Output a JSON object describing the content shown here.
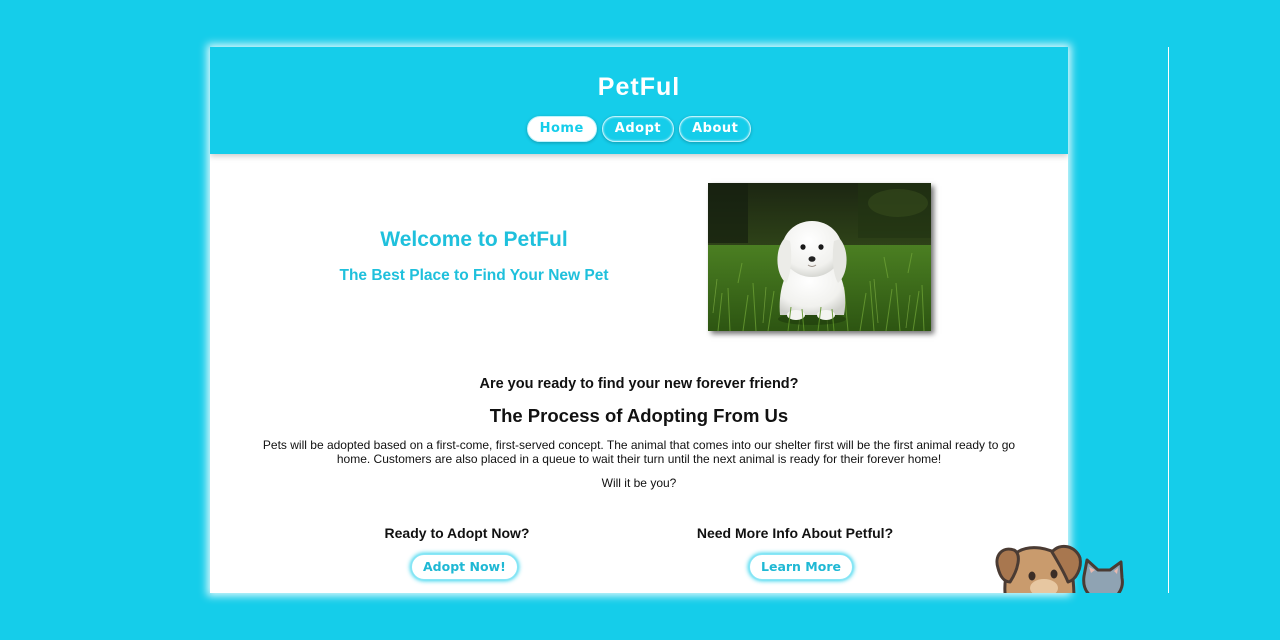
{
  "site": {
    "title": "PetFul"
  },
  "nav": {
    "items": [
      {
        "label": "Home",
        "active": true
      },
      {
        "label": "Adopt",
        "active": false
      },
      {
        "label": "About",
        "active": false
      }
    ]
  },
  "hero": {
    "title": "Welcome to PetFul",
    "subtitle": "The Best Place to Find Your New Pet",
    "image": "white-maltese-puppy-on-grass"
  },
  "process": {
    "question": "Are you ready to find your new forever friend?",
    "title": "The Process of Adopting From Us",
    "description": "Pets will be adopted based on a first-come, first-served concept. The animal that comes into our shelter first will be the first animal ready to go home. Customers are also placed in a queue to wait their turn until the next animal is ready for their forever home!",
    "closing": "Will it be you?"
  },
  "cta": {
    "adopt_heading": "Ready to Adopt Now?",
    "adopt_button": "Adopt Now!",
    "info_heading": "Need More Info About Petful?",
    "info_button": "Learn More"
  },
  "colors": {
    "brand": "#15cdea",
    "accent_text": "#1fc0dc",
    "body_text": "#111111",
    "panel": "#ffffff"
  },
  "decor": {
    "mascot": "dog-and-cat-peeking-icon"
  }
}
